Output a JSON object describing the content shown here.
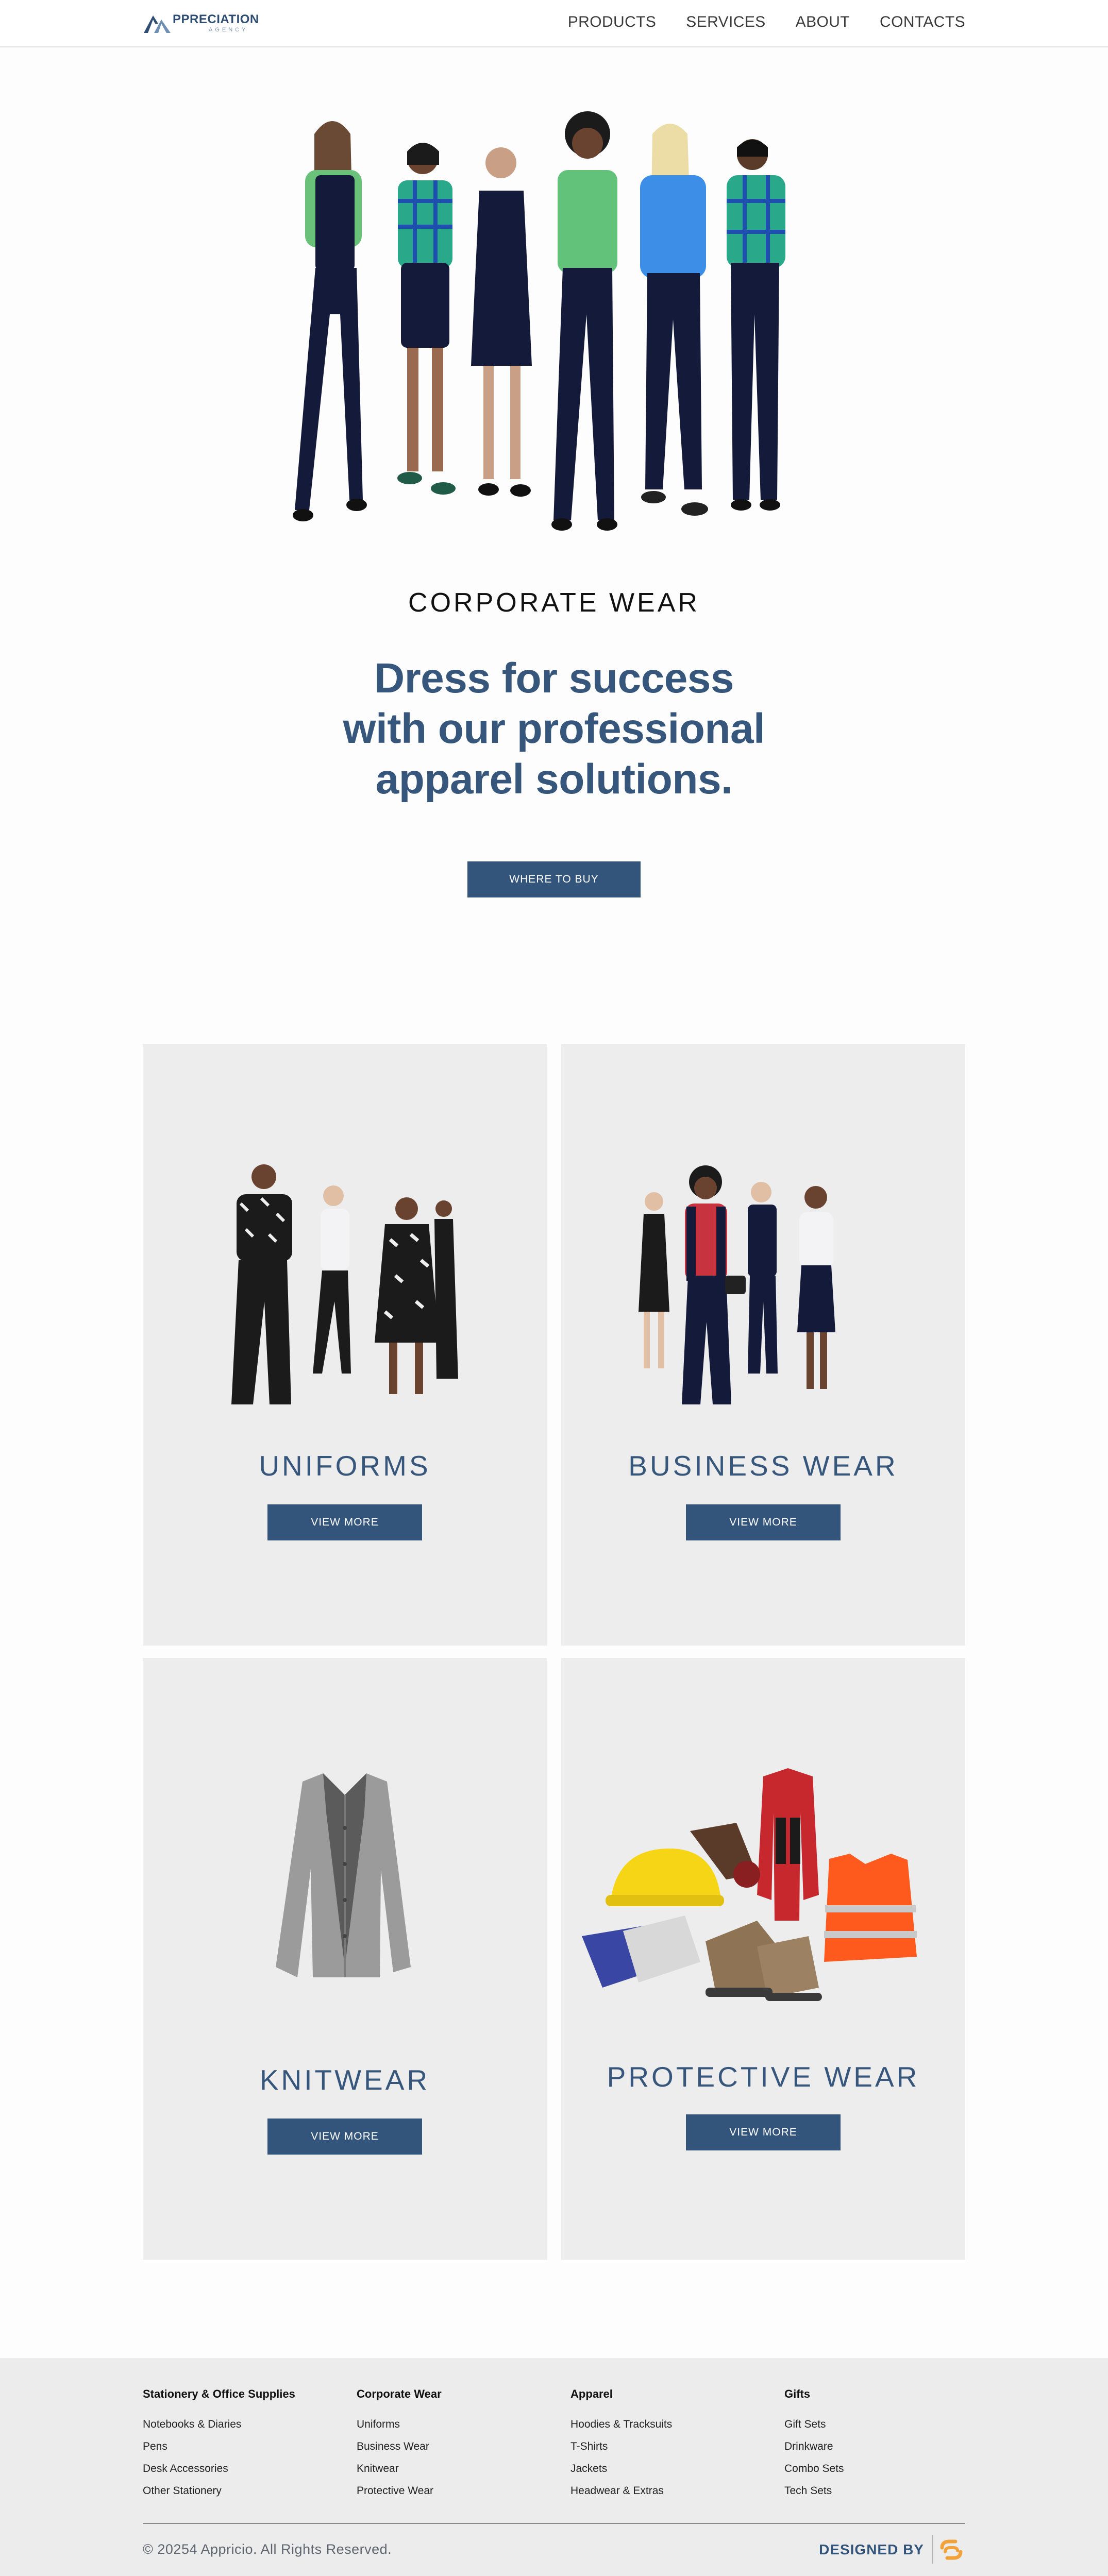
{
  "header": {
    "logo_main": "PPRECIATION",
    "logo_sub": "AGENCY",
    "nav": [
      "PRODUCTS",
      "SERVICES",
      "ABOUT",
      "CONTACTS"
    ]
  },
  "hero": {
    "label": "CORPORATE WEAR",
    "title_lines": [
      "Dress for success",
      "with our professional",
      "apparel solutions."
    ],
    "button": "WHERE TO BUY"
  },
  "cards": [
    {
      "title": "UNIFORMS",
      "button": "VIEW MORE"
    },
    {
      "title": "BUSINESS WEAR",
      "button": "VIEW MORE"
    },
    {
      "title": "KNITWEAR",
      "button": "VIEW MORE"
    },
    {
      "title": "PROTECTIVE WEAR",
      "button": "VIEW MORE"
    }
  ],
  "footer": {
    "columns": [
      {
        "heading": "Stationery & Office Supplies",
        "links": [
          "Notebooks & Diaries",
          "Pens",
          "Desk Accessories",
          "Other Stationery"
        ]
      },
      {
        "heading": "Corporate Wear",
        "links": [
          "Uniforms",
          "Business Wear",
          "Knitwear",
          "Protective Wear"
        ]
      },
      {
        "heading": "Apparel",
        "links": [
          "Hoodies & Tracksuits",
          "T-Shirts",
          "Jackets",
          "Headwear & Extras"
        ]
      },
      {
        "heading": "Gifts",
        "links": [
          "Gift Sets",
          "Drinkware",
          "Combo Sets",
          "Tech Sets"
        ]
      }
    ],
    "copyright": "© 20254 Appricio. All Rights Reserved.",
    "designed_by": "DESIGNED BY"
  },
  "colors": {
    "primary": "#34557b",
    "card_bg": "#ededed",
    "footer_bg": "#ececec",
    "accent_orange": "#f2a23a"
  }
}
